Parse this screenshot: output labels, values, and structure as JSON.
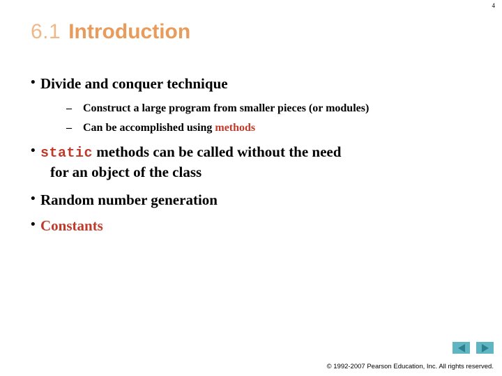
{
  "slide": {
    "page_number": "4",
    "title": {
      "number": "6.1",
      "text": "Introduction"
    },
    "colors": {
      "title_number": "#eeb98a",
      "title_text": "#e89b5a",
      "accent_red": "#c1392a",
      "body_text": "#000000",
      "nav_button_bg": "#5fb6c2",
      "nav_arrow": "#2f7f8c",
      "background": "#ffffff"
    },
    "bullets": {
      "divide": "Divide and conquer technique",
      "construct": "Construct a large program from smaller pieces (or modules)",
      "can_be_prefix": "Can be accomplished using ",
      "can_be_accent": "methods",
      "static_code": "static",
      "static_rest": " methods can be called without the need",
      "static_continuation": "for an object of the class",
      "random": "Random number generation",
      "constants": "Constants"
    },
    "marks": {
      "bullet": "•",
      "dash": "–"
    },
    "nav": {
      "previous_label": "Previous slide",
      "next_label": "Next slide"
    },
    "footer": "© 1992-2007 Pearson Education, Inc.  All rights reserved."
  }
}
